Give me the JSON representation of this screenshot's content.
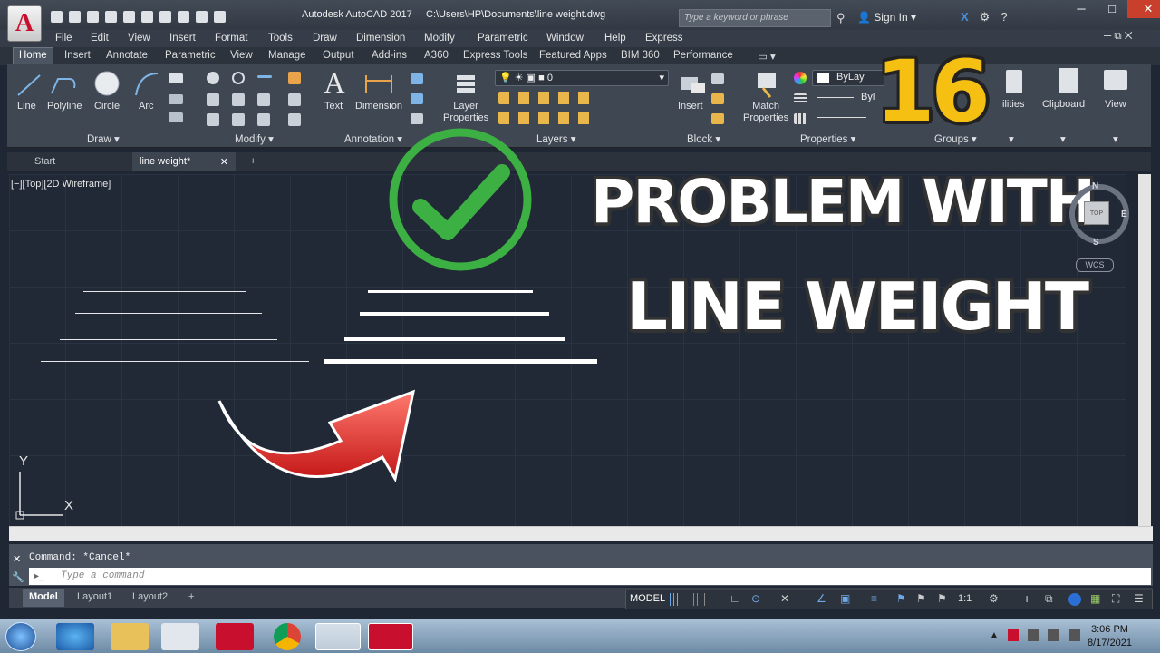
{
  "app": {
    "logo_letter": "A",
    "title": "Autodesk AutoCAD 2017",
    "path": "C:\\Users\\HP\\Documents\\line weight.dwg"
  },
  "search": {
    "placeholder": "Type a keyword or phrase"
  },
  "account": {
    "signin": "Sign In"
  },
  "menu": [
    "File",
    "Edit",
    "View",
    "Insert",
    "Format",
    "Tools",
    "Draw",
    "Dimension",
    "Modify",
    "Parametric",
    "Window",
    "Help",
    "Express"
  ],
  "ribbon_tabs": [
    "Home",
    "Insert",
    "Annotate",
    "Parametric",
    "View",
    "Manage",
    "Output",
    "Add-ins",
    "A360",
    "Express Tools",
    "Featured Apps",
    "BIM 360",
    "Performance"
  ],
  "ribbon": {
    "draw": {
      "title": "Draw",
      "line": "Line",
      "polyline": "Polyline",
      "circle": "Circle",
      "arc": "Arc"
    },
    "modify": {
      "title": "Modify"
    },
    "annotation": {
      "title": "Annotation",
      "text": "Text",
      "dimension": "Dimension"
    },
    "layers": {
      "title": "Layers",
      "layer_properties_1": "Layer",
      "layer_properties_2": "Properties",
      "current_layer": "0"
    },
    "block": {
      "title": "Block",
      "insert": "Insert"
    },
    "properties": {
      "title": "Properties",
      "match_1": "Match",
      "match_2": "Properties",
      "bylayer": "ByLay",
      "byl": "Byl"
    },
    "groups": {
      "title": "Groups"
    },
    "utilities": {
      "label": "ilities"
    },
    "clipboard": {
      "label": "Clipboard"
    },
    "view": {
      "label": "View"
    }
  },
  "doc_tabs": [
    "Start",
    "line weight*"
  ],
  "viewport": {
    "label": "[−][Top][2D Wireframe]",
    "compass": {
      "n": "N",
      "e": "E",
      "s": "S",
      "top": "TOP",
      "wcs": "WCS"
    },
    "ucs_x": "X",
    "ucs_y": "Y"
  },
  "overlay": {
    "number": "16",
    "line1": "PROBLEM WITH",
    "line2": "LINE WEIGHT"
  },
  "command": {
    "history": "Command: *Cancel*",
    "placeholder": "Type a command"
  },
  "layout_tabs": [
    "Model",
    "Layout1",
    "Layout2"
  ],
  "status": {
    "model": "MODEL",
    "scale": "1:1"
  },
  "clock": {
    "time": "3:06 PM",
    "date": "8/17/2021"
  },
  "colors": {
    "accent": "#f6c012",
    "check": "#3cb043",
    "arrow": "#e3302b"
  }
}
